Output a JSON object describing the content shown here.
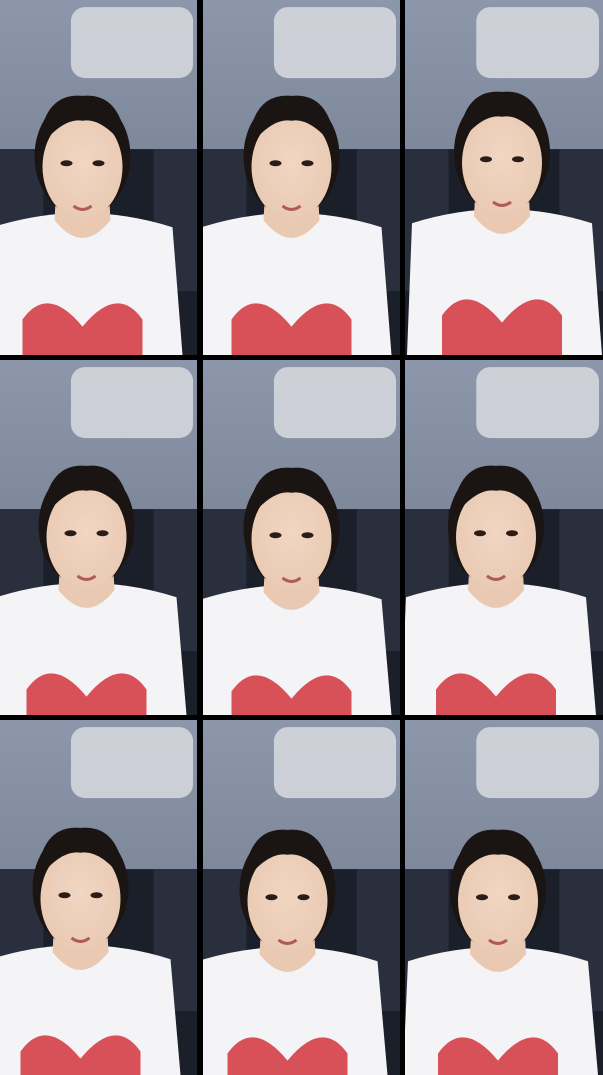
{
  "layout": {
    "rows": 3,
    "columns": 3,
    "frame_count": 9
  },
  "colors": {
    "background": "#000000",
    "gutter": "#000000",
    "ceiling": "#6b7486",
    "car_interior": "#1b1f2a",
    "curtain": "#2a2f3d",
    "sun_visor": "#d9dbe0",
    "hair": "#1a1412",
    "skin": "#e9c9b2",
    "shirt": "#f4f4f6",
    "heart_print": "#d2323c"
  },
  "frames": [
    {
      "id": "frame-1",
      "subject": "woman-white-tshirt-heart-print",
      "setting": "car-interior"
    },
    {
      "id": "frame-2",
      "subject": "woman-white-tshirt-heart-print",
      "setting": "car-interior"
    },
    {
      "id": "frame-3",
      "subject": "woman-white-tshirt-heart-print",
      "setting": "car-interior"
    },
    {
      "id": "frame-4",
      "subject": "woman-white-tshirt-heart-print",
      "setting": "car-interior"
    },
    {
      "id": "frame-5",
      "subject": "woman-white-tshirt-heart-print",
      "setting": "car-interior"
    },
    {
      "id": "frame-6",
      "subject": "woman-white-tshirt-heart-print",
      "setting": "car-interior"
    },
    {
      "id": "frame-7",
      "subject": "woman-white-tshirt-heart-print",
      "setting": "car-interior"
    },
    {
      "id": "frame-8",
      "subject": "woman-white-tshirt-heart-print",
      "setting": "car-interior"
    },
    {
      "id": "frame-9",
      "subject": "woman-white-tshirt-heart-print",
      "setting": "car-interior"
    }
  ]
}
